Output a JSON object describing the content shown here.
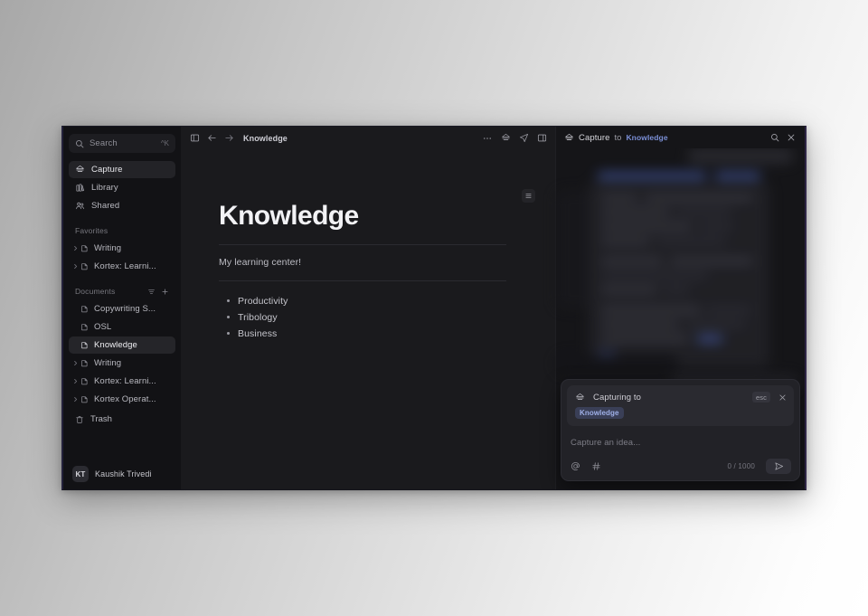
{
  "window": {
    "accent_left": "#23213a",
    "accent_right": "#2e2545"
  },
  "sidebar": {
    "search": {
      "placeholder": "Search",
      "shortcut": "^K",
      "icon": "search-icon"
    },
    "nav": [
      {
        "label": "Capture",
        "icon": "capture-icon",
        "active": true
      },
      {
        "label": "Library",
        "icon": "library-icon",
        "active": false
      },
      {
        "label": "Shared",
        "icon": "shared-users-icon",
        "active": false
      }
    ],
    "favorites": {
      "title": "Favorites",
      "items": [
        {
          "label": "Writing",
          "icon": "document-icon",
          "chevron": "chevron-right-icon"
        },
        {
          "label": "Kortex: Learni...",
          "icon": "document-icon",
          "chevron": "chevron-right-icon"
        }
      ]
    },
    "documents": {
      "title": "Documents",
      "actions": [
        {
          "icon": "filter-sort-icon"
        },
        {
          "icon": "plus-icon"
        }
      ],
      "items": [
        {
          "label": "Copywriting S...",
          "icon": "document-icon",
          "chevron": false,
          "active": false
        },
        {
          "label": "OSL",
          "icon": "document-icon",
          "chevron": false,
          "active": false
        },
        {
          "label": "Knowledge",
          "icon": "document-icon",
          "chevron": false,
          "active": true
        },
        {
          "label": "Writing",
          "icon": "document-icon",
          "chevron": true,
          "active": false
        },
        {
          "label": "Kortex: Learni...",
          "icon": "document-icon",
          "chevron": true,
          "active": false
        },
        {
          "label": "Kortex Operat...",
          "icon": "document-icon",
          "chevron": true,
          "active": false
        }
      ]
    },
    "trash": {
      "label": "Trash",
      "icon": "trash-icon"
    },
    "user": {
      "initials": "KT",
      "name": "Kaushik Trivedi"
    }
  },
  "main": {
    "toolbar": {
      "sidebar_toggle_icon": "panel-left-icon",
      "back_icon": "arrow-left-icon",
      "forward_icon": "arrow-right-icon",
      "breadcrumb": "Knowledge",
      "right_icons": [
        {
          "icon": "more-horizontal-icon"
        },
        {
          "icon": "capture-icon"
        },
        {
          "icon": "send-plane-icon"
        },
        {
          "icon": "panel-right-icon"
        }
      ]
    },
    "outline_button_icon": "list-outline-icon",
    "document": {
      "title": "Knowledge",
      "subtitle": "My learning center!",
      "bullets": [
        "Productivity",
        "Tribology",
        "Business"
      ]
    }
  },
  "capture_panel": {
    "header": {
      "icon": "capture-icon",
      "title": "Capture",
      "to_label": "to",
      "destination": "Knowledge",
      "search_icon": "search-icon",
      "close_icon": "close-icon"
    },
    "composer": {
      "icon": "capture-icon",
      "capturing_label": "Capturing to",
      "esc_key": "esc",
      "close_icon": "close-icon",
      "destination_chip": "Knowledge",
      "input_placeholder": "Capture an idea...",
      "mention_icon": "at-mention-icon",
      "tag_icon": "hash-tag-icon",
      "char_count": "0 / 1000",
      "send_icon": "send-plane-icon"
    }
  }
}
